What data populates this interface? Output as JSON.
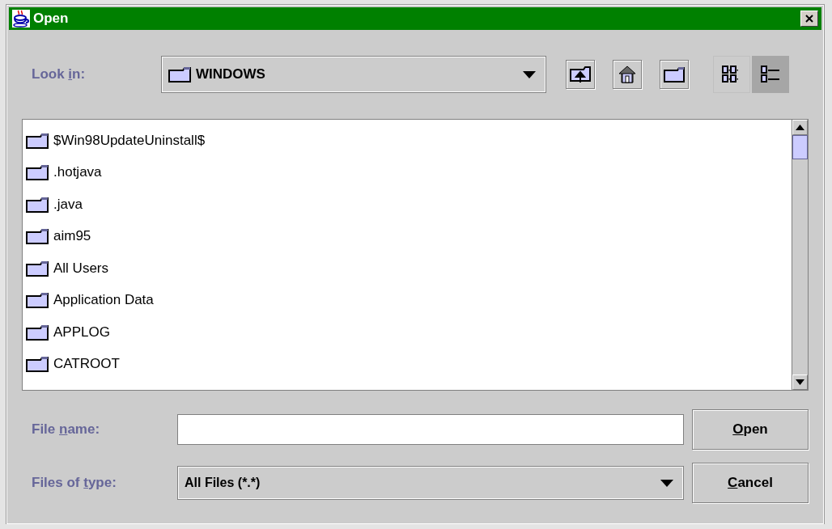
{
  "window": {
    "title": "Open"
  },
  "look_in": {
    "label": [
      "Look ",
      "i",
      "n:"
    ],
    "value": "WINDOWS"
  },
  "toolbar": [
    {
      "kind": "up",
      "selected": false
    },
    {
      "kind": "home",
      "selected": false
    },
    {
      "kind": "new-folder",
      "selected": false
    },
    {
      "kind": "list",
      "selected": false
    },
    {
      "kind": "details",
      "selected": true
    }
  ],
  "files": [
    {
      "name": "$Win98UpdateUninstall$"
    },
    {
      "name": ".hotjava"
    },
    {
      "name": ".java"
    },
    {
      "name": "aim95"
    },
    {
      "name": "All Users"
    },
    {
      "name": "Application Data"
    },
    {
      "name": "APPLOG"
    },
    {
      "name": "CATROOT"
    }
  ],
  "file_name": {
    "label": [
      "File ",
      "n",
      "ame:"
    ]
  },
  "file_type": {
    "label": [
      "Files of ",
      "t",
      "ype:"
    ],
    "value": "All Files (*.*)"
  },
  "buttons": [
    {
      "key": "O",
      "rest": "pen"
    },
    {
      "key": "C",
      "rest": "ancel"
    }
  ]
}
